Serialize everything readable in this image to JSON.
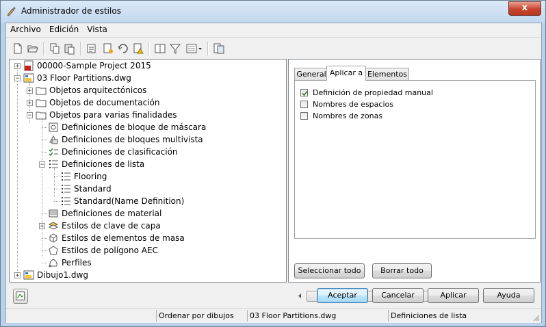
{
  "window": {
    "title": "Administrador de estilos",
    "close_glyph": "x",
    "app_icon": "style-manager-icon"
  },
  "menu": [
    {
      "label": "Archivo"
    },
    {
      "label": "Edición"
    },
    {
      "label": "Vista"
    }
  ],
  "toolbar": {
    "icons": [
      "new-icon",
      "open-icon",
      "copy-icon",
      "paste-icon",
      "purge-icon",
      "new-style-icon",
      "edit-style-icon",
      "warning-style-icon",
      "duplicate-icon",
      "filter-icon",
      "view-dropdown-icon",
      "refresh-icon"
    ]
  },
  "tree": {
    "items": [
      {
        "label": "00000-Sample Project 2015",
        "icon": "project-pdf-icon"
      },
      {
        "label": "03 Floor Partitions.dwg",
        "icon": "drawing-icon"
      },
      {
        "label": "Objetos arquitectónicos",
        "icon": "folder-icon"
      },
      {
        "label": "Objetos de documentación",
        "icon": "folder-icon"
      },
      {
        "label": "Objetos para varias finalidades",
        "icon": "folder-open-icon"
      },
      {
        "label": "Definiciones de bloque de máscara",
        "icon": "mask-block-icon"
      },
      {
        "label": "Definiciones de bloques multivista",
        "icon": "multiview-block-icon"
      },
      {
        "label": "Definiciones de clasificación",
        "icon": "classification-icon"
      },
      {
        "label": "Definiciones de lista",
        "icon": "list-icon"
      },
      {
        "label": "Flooring",
        "icon": "list-icon"
      },
      {
        "label": "Standard",
        "icon": "list-icon"
      },
      {
        "label": "Standard(Name Definition)",
        "icon": "list-icon"
      },
      {
        "label": "Definiciones de material",
        "icon": "material-icon"
      },
      {
        "label": "Estilos de clave de capa",
        "icon": "layer-key-icon"
      },
      {
        "label": "Estilos de elementos de masa",
        "icon": "mass-element-icon"
      },
      {
        "label": "Estilos de polígono AEC",
        "icon": "polygon-icon"
      },
      {
        "label": "Perfiles",
        "icon": "profile-icon"
      },
      {
        "label": "Dibujo1.dwg",
        "icon": "drawing-icon"
      }
    ]
  },
  "tabs": [
    {
      "label": "General"
    },
    {
      "label": "Aplicar a"
    },
    {
      "label": "Elementos"
    }
  ],
  "apply_to": {
    "checkboxes": [
      {
        "label": "Definición de propiedad manual",
        "checked": true
      },
      {
        "label": "Nombres de espacios",
        "checked": false
      },
      {
        "label": "Nombres de zonas",
        "checked": false
      }
    ],
    "select_all": "Seleccionar todo",
    "clear_all": "Borrar todo"
  },
  "buttons": {
    "ok": "Aceptar",
    "cancel": "Cancelar",
    "apply": "Aplicar",
    "help": "Ayuda"
  },
  "status": {
    "sort": "Ordenar por dibujos",
    "drawing": "03 Floor Partitions.dwg",
    "section": "Definiciones de lista"
  }
}
